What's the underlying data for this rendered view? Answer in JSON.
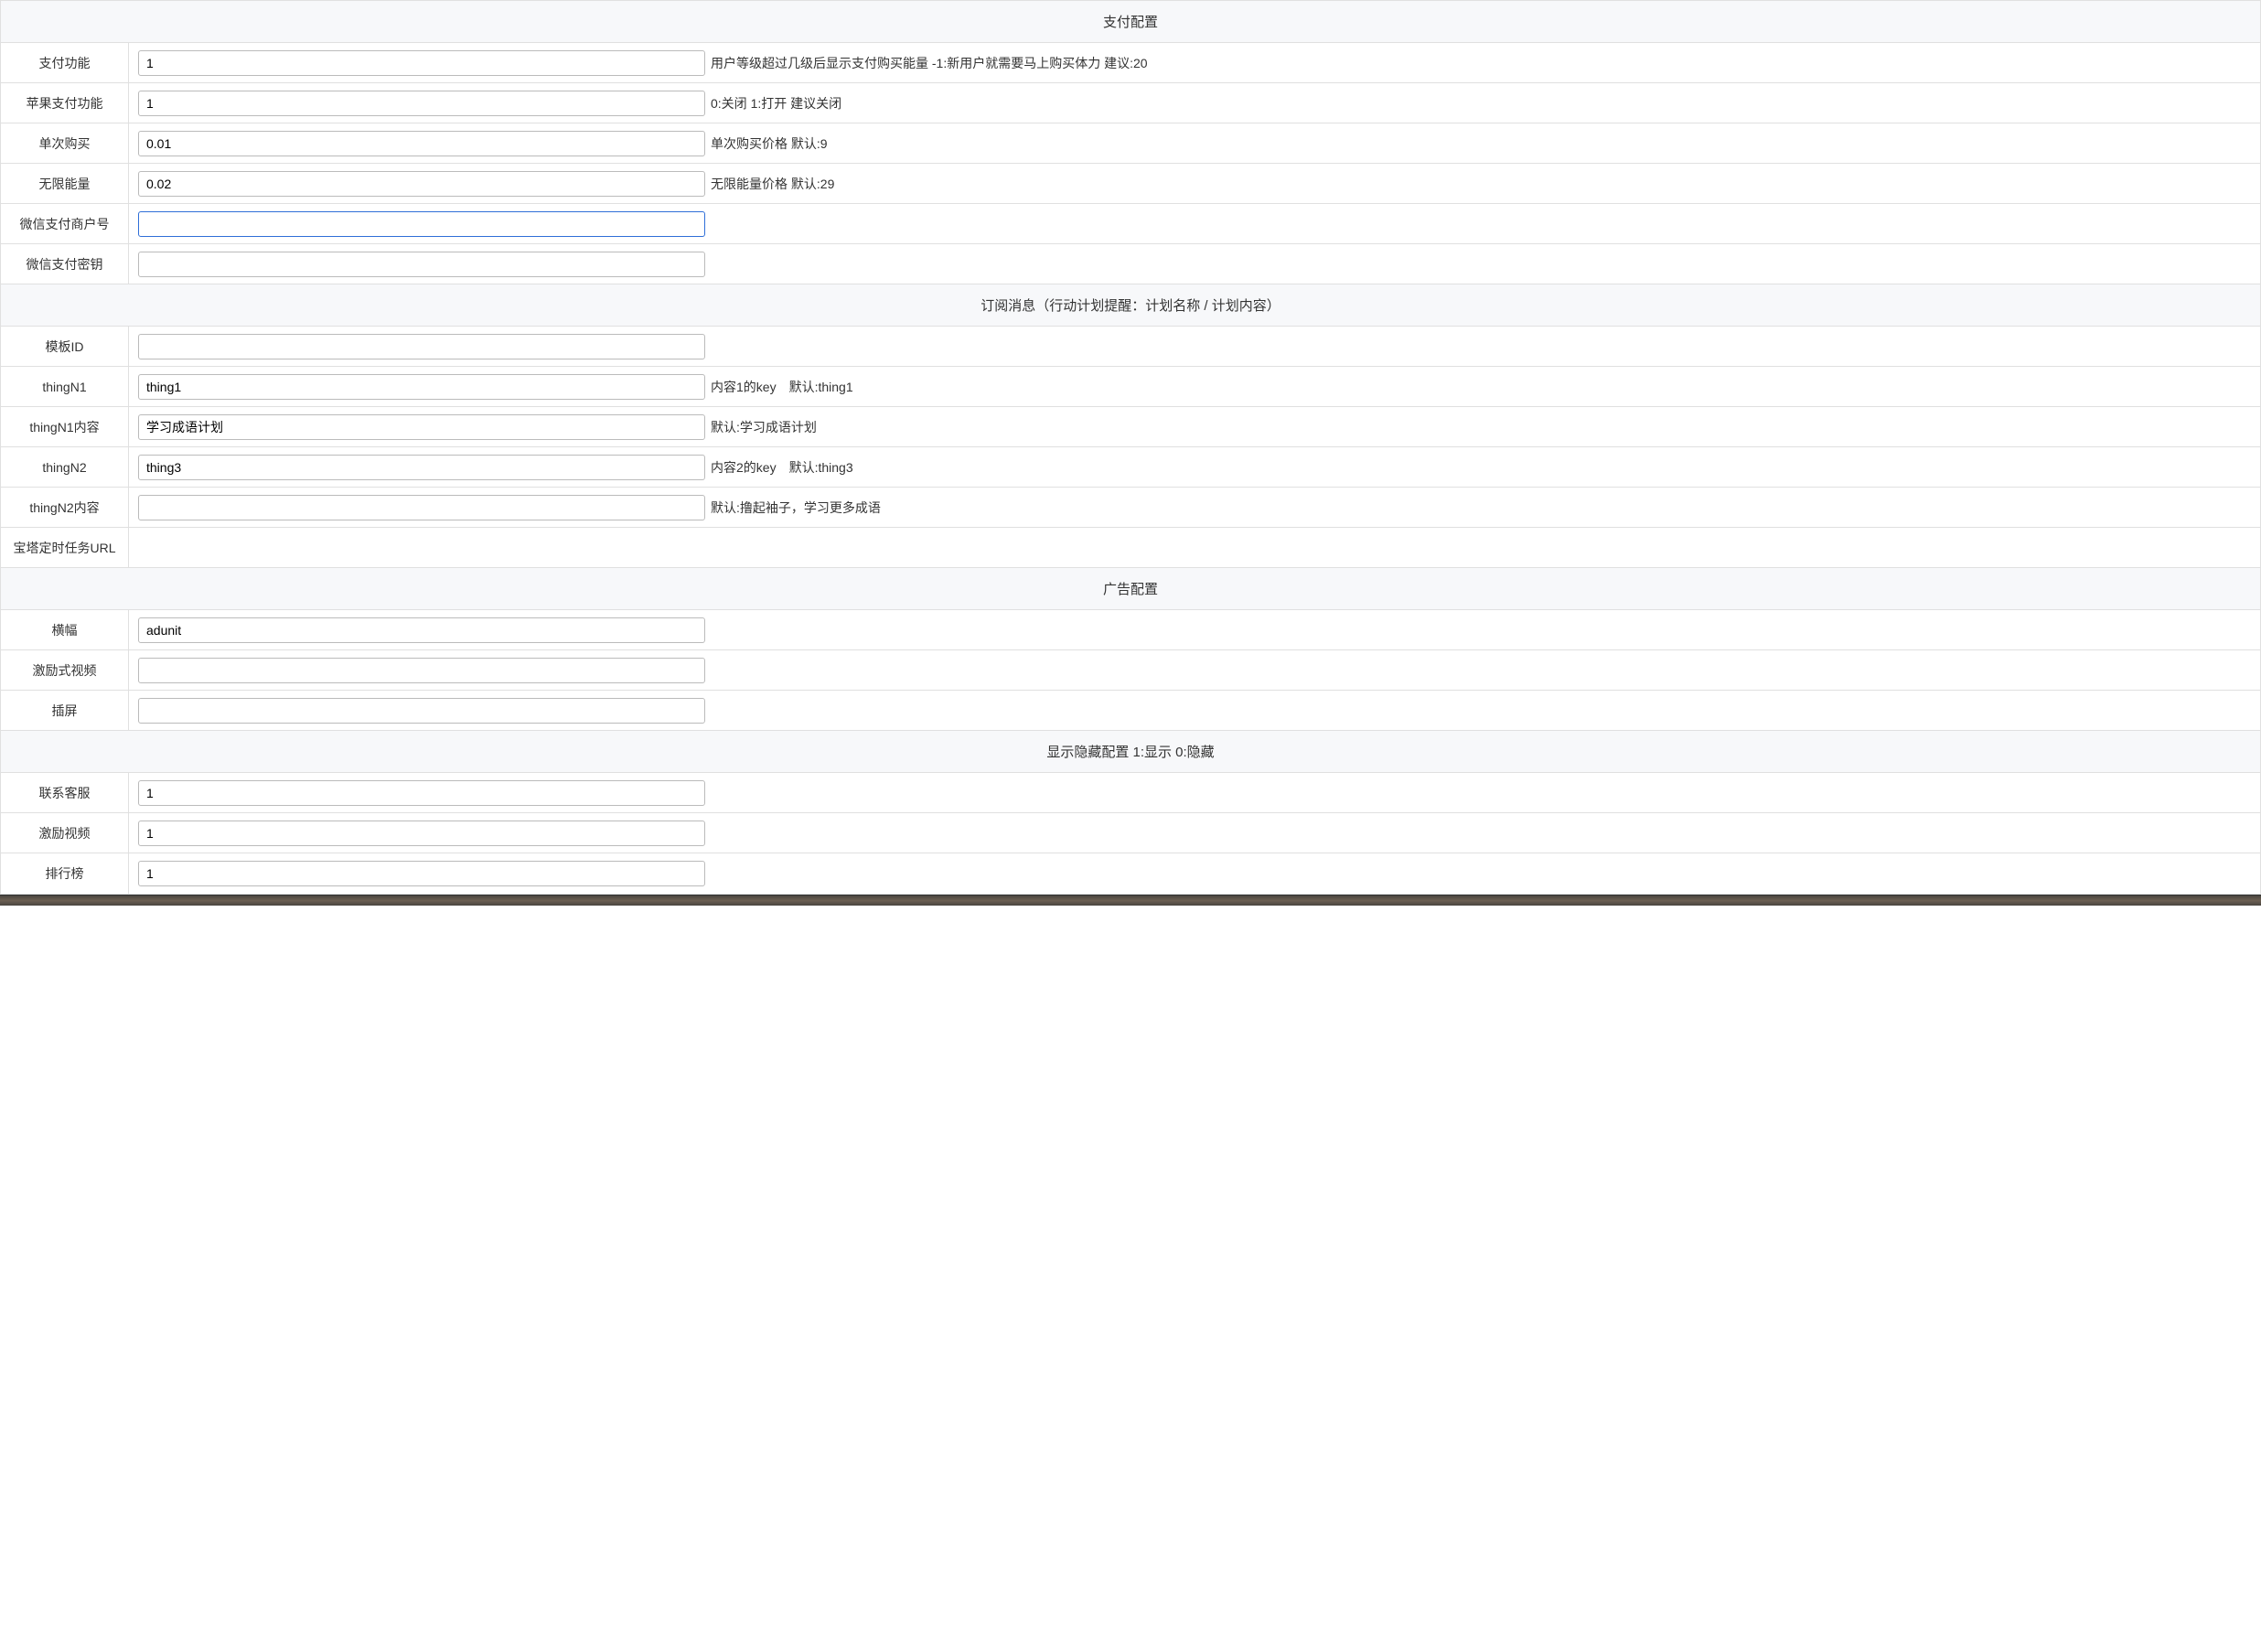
{
  "sections": {
    "payment": {
      "title": "支付配置",
      "fields": {
        "pay_func": {
          "label": "支付功能",
          "value": "1",
          "hint": "用户等级超过几级后显示支付购买能量 -1:新用户就需要马上购买体力 建议:20"
        },
        "apple_pay": {
          "label": "苹果支付功能",
          "value": "1",
          "hint": "0:关闭 1:打开 建议关闭"
        },
        "single_buy": {
          "label": "单次购买",
          "value": "0.01",
          "hint": "单次购买价格 默认:9"
        },
        "unlimited_energy": {
          "label": "无限能量",
          "value": "0.02",
          "hint": "无限能量价格 默认:29"
        },
        "wx_merchant": {
          "label": "微信支付商户号",
          "value": "",
          "hint": ""
        },
        "wx_secret": {
          "label": "微信支付密钥",
          "value": "",
          "hint": ""
        }
      }
    },
    "subscribe": {
      "title": "订阅消息（行动计划提醒：计划名称 / 计划内容）",
      "fields": {
        "template_id": {
          "label": "模板ID",
          "value": "",
          "hint": ""
        },
        "thing_n1": {
          "label": "thingN1",
          "value": "thing1",
          "hint": "内容1的key　默认:thing1"
        },
        "thing_n1_content": {
          "label": "thingN1内容",
          "value": "学习成语计划",
          "hint": "默认:学习成语计划"
        },
        "thing_n2": {
          "label": "thingN2",
          "value": "thing3",
          "hint": "内容2的key　默认:thing3"
        },
        "thing_n2_content": {
          "label": "thingN2内容",
          "value": "",
          "hint": "默认:撸起袖子，学习更多成语"
        },
        "cron_url": {
          "label": "宝塔定时任务URL",
          "value": "",
          "hint": "",
          "no_input": true
        }
      }
    },
    "ad": {
      "title": "广告配置",
      "fields": {
        "banner": {
          "label": "横幅",
          "value": "adunit",
          "hint": ""
        },
        "reward_video": {
          "label": "激励式视频",
          "value": "",
          "hint": ""
        },
        "interstitial": {
          "label": "插屏",
          "value": "",
          "hint": ""
        }
      }
    },
    "visibility": {
      "title": "显示隐藏配置 1:显示 0:隐藏",
      "fields": {
        "contact": {
          "label": "联系客服",
          "value": "1",
          "hint": ""
        },
        "reward_vid": {
          "label": "激励视频",
          "value": "1",
          "hint": ""
        },
        "ranking": {
          "label": "排行榜",
          "value": "1",
          "hint": ""
        }
      }
    }
  }
}
